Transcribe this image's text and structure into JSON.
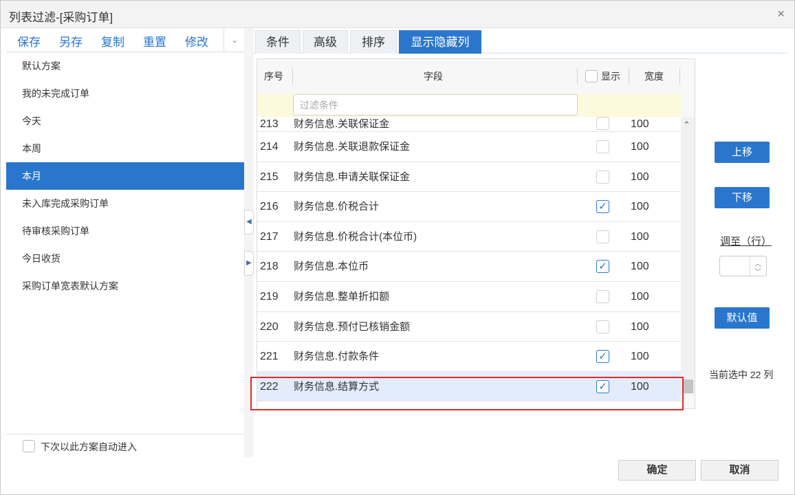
{
  "dialog": {
    "title": "列表过滤-[采购订单]",
    "close_glyph": "×"
  },
  "toolbar": {
    "save": "保存",
    "save_as": "另存",
    "copy": "复制",
    "reset": "重置",
    "modify": "修改",
    "dropdown_glyph": "⌄"
  },
  "schemes": [
    {
      "label": "默认方案"
    },
    {
      "label": "我的未完成订单"
    },
    {
      "label": "今天"
    },
    {
      "label": "本周"
    },
    {
      "label": "本月",
      "selected": true
    },
    {
      "label": "未入库完成采购订单"
    },
    {
      "label": "待审核采购订单"
    },
    {
      "label": "今日收货"
    },
    {
      "label": "采购订单宽表默认方案"
    }
  ],
  "auto_enter_label": "下次以此方案自动进入",
  "tabs": [
    {
      "label": "条件"
    },
    {
      "label": "高级"
    },
    {
      "label": "排序"
    },
    {
      "label": "显示隐藏列",
      "active": true
    }
  ],
  "grid": {
    "headers": {
      "seq": "序号",
      "field": "字段",
      "show": "显示",
      "width": "宽度"
    },
    "filter_placeholder": "过滤条件",
    "rows": [
      {
        "seq": "213",
        "field": "财务信息.关联保证金",
        "show": false,
        "width": "100"
      },
      {
        "seq": "214",
        "field": "财务信息.关联退款保证金",
        "show": false,
        "width": "100"
      },
      {
        "seq": "215",
        "field": "财务信息.申请关联保证金",
        "show": false,
        "width": "100"
      },
      {
        "seq": "216",
        "field": "财务信息.价税合计",
        "show": true,
        "width": "100"
      },
      {
        "seq": "217",
        "field": "财务信息.价税合计(本位币)",
        "show": false,
        "width": "100"
      },
      {
        "seq": "218",
        "field": "财务信息.本位币",
        "show": true,
        "width": "100"
      },
      {
        "seq": "219",
        "field": "财务信息.整单折扣额",
        "show": false,
        "width": "100"
      },
      {
        "seq": "220",
        "field": "财务信息.预付已核销金额",
        "show": false,
        "width": "100"
      },
      {
        "seq": "221",
        "field": "财务信息.付款条件",
        "show": true,
        "width": "100"
      },
      {
        "seq": "222",
        "field": "财务信息.结算方式",
        "show": true,
        "width": "100",
        "selected": true
      }
    ]
  },
  "side": {
    "move_up": "上移",
    "move_down": "下移",
    "goto_label": "调至（行）",
    "goto_value": "",
    "default": "默认值",
    "status": "当前选中 22 列"
  },
  "footer": {
    "ok": "确定",
    "cancel": "取消"
  },
  "icons": {
    "close": "close-icon",
    "collapse_left": "triangle-left-icon",
    "expand_right": "triangle-right-icon",
    "scroll_up": "chevron-up-icon",
    "scroll_down": "chevron-down-icon",
    "check": "checkmark-icon"
  },
  "colors": {
    "accent": "#2a76cc",
    "highlight_border": "#e02b2b",
    "filter_row": "#fdf9dc",
    "selected_row": "#e3ecfb"
  }
}
